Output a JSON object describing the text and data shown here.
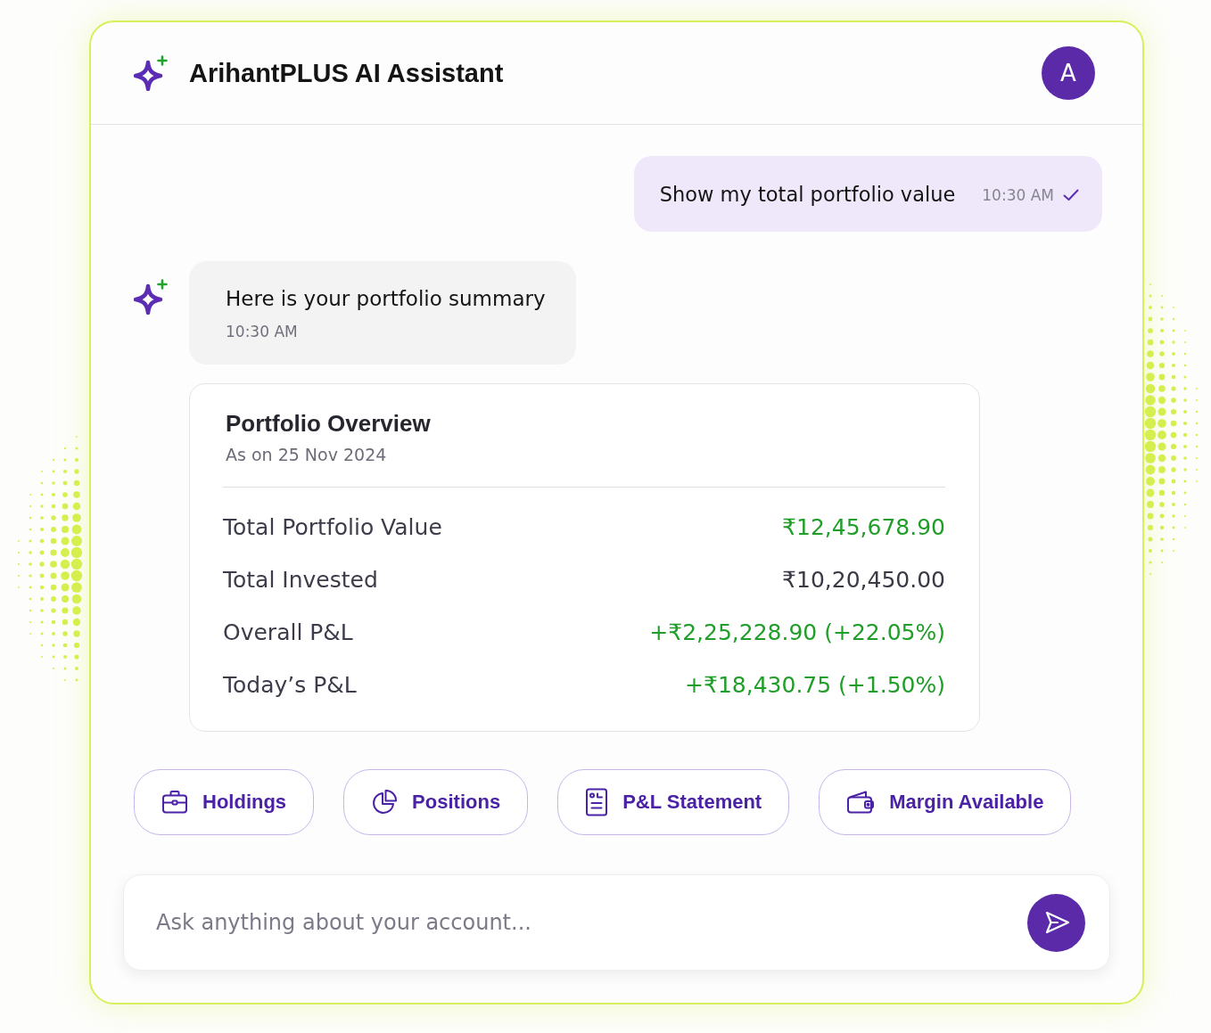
{
  "assistant": {
    "title": "ArihantPLUS AI Assistant",
    "avatar_initial": "A"
  },
  "messages": [
    {
      "kind": "user",
      "text": "Show my total portfolio value",
      "time": "10:30 AM",
      "read": true
    },
    {
      "kind": "bot",
      "text": "Here is your portfolio summary",
      "time": "10:30 AM"
    }
  ],
  "overview": {
    "title": "Portfolio Overview",
    "subtitle": "As on 25 Nov 2024",
    "rows": [
      {
        "label": "Total Portfolio Value",
        "value": "₹12,45,678.90",
        "color": "#1f9e28"
      },
      {
        "label": "Total Invested",
        "value": "₹10,20,450.00",
        "color": "#3a3a46"
      },
      {
        "label": "Overall P&L",
        "value": "+₹2,25,228.90 (+22.05%)",
        "color": "#1f9e28"
      },
      {
        "label": "Today’s P&L",
        "value": "+₹18,430.75 (+1.50%)",
        "color": "#1f9e28"
      }
    ]
  },
  "quick_actions": [
    {
      "label": "Holdings",
      "kind": "holdings"
    },
    {
      "label": "Positions",
      "kind": "positions"
    },
    {
      "label": "P&L Statement",
      "kind": "statement"
    },
    {
      "label": "Margin Available",
      "kind": "margin"
    }
  ],
  "composer": {
    "placeholder": "Ask anything about your account..."
  }
}
